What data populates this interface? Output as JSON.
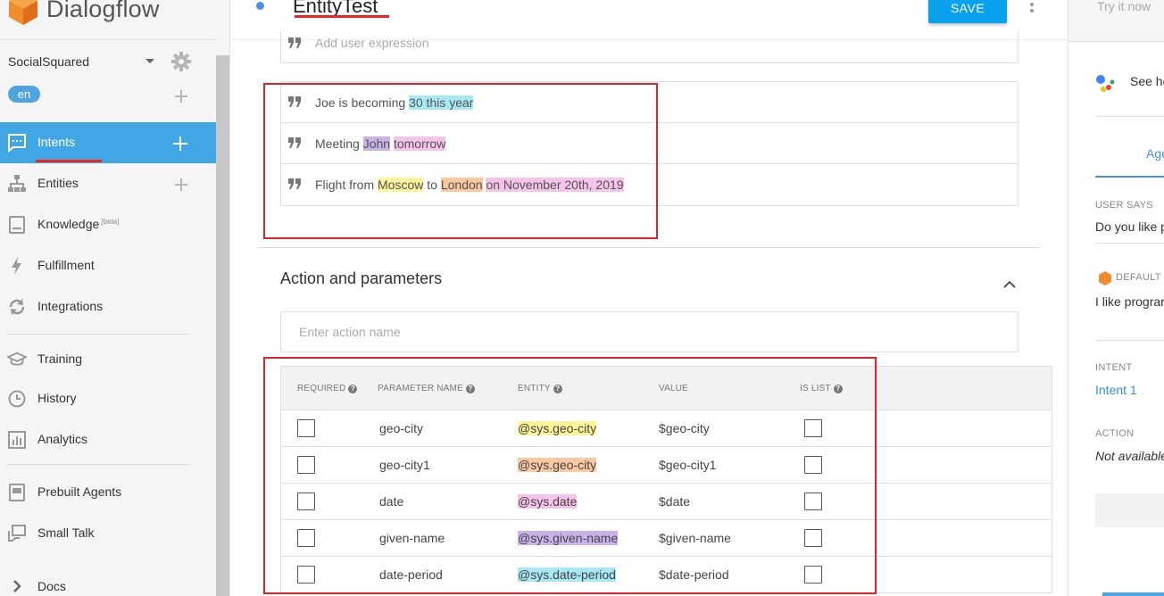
{
  "brand": {
    "name": "Dialogflow"
  },
  "agent": {
    "name": "SocialSquared",
    "language": "en"
  },
  "nav": {
    "intents": "Intents",
    "entities": "Entities",
    "knowledge": "Knowledge",
    "knowledge_badge": "[beta]",
    "fulfillment": "Fulfillment",
    "integrations": "Integrations",
    "training": "Training",
    "history": "History",
    "analytics": "Analytics",
    "prebuilt_agents": "Prebuilt Agents",
    "small_talk": "Small Talk",
    "docs": "Docs"
  },
  "header": {
    "intent_name": "EntityTest",
    "save_label": "SAVE"
  },
  "training_phrases": {
    "add_placeholder": "Add user expression",
    "phrases": [
      {
        "segments": [
          {
            "text": "Joe is becoming "
          },
          {
            "text": "30 this year",
            "entity": "cyan"
          }
        ]
      },
      {
        "segments": [
          {
            "text": "Meeting "
          },
          {
            "text": "John",
            "entity": "purple"
          },
          {
            "text": " "
          },
          {
            "text": "tomorrow",
            "entity": "pink"
          }
        ]
      },
      {
        "segments": [
          {
            "text": "Flight from "
          },
          {
            "text": "Moscow",
            "entity": "yellow"
          },
          {
            "text": " to "
          },
          {
            "text": "London",
            "entity": "orange"
          },
          {
            "text": " "
          },
          {
            "text": "on November 20th, 2019",
            "entity": "pink"
          }
        ]
      }
    ]
  },
  "action_section": {
    "title": "Action and parameters",
    "action_placeholder": "Enter action name",
    "columns": {
      "required": "REQUIRED",
      "parameter_name": "PARAMETER NAME",
      "entity": "ENTITY",
      "value": "VALUE",
      "is_list": "IS LIST"
    },
    "rows": [
      {
        "required": false,
        "name": "geo-city",
        "entity": "@sys.geo-city",
        "entity_color": "yellow",
        "value": "$geo-city",
        "is_list": false
      },
      {
        "required": false,
        "name": "geo-city1",
        "entity": "@sys.geo-city",
        "entity_color": "orange",
        "value": "$geo-city1",
        "is_list": false
      },
      {
        "required": false,
        "name": "date",
        "entity": "@sys.date",
        "entity_color": "pink",
        "value": "$date",
        "is_list": false
      },
      {
        "required": false,
        "name": "given-name",
        "entity": "@sys.given-name",
        "entity_color": "purple",
        "value": "$given-name",
        "is_list": false
      },
      {
        "required": false,
        "name": "date-period",
        "entity": "@sys.date-period",
        "entity_color": "cyan",
        "value": "$date-period",
        "is_list": false
      }
    ]
  },
  "right_panel": {
    "try_it": "Try it now",
    "see_how": "See ho",
    "tab": "Age",
    "user_says_label": "USER SAYS",
    "user_says_value": "Do you like p",
    "default_label": "DEFAULT",
    "default_value": "I like prograr",
    "intent_label": "INTENT",
    "intent_value": "Intent 1",
    "action_label": "ACTION",
    "action_value": "Not available"
  },
  "colors": {
    "accent": "#41a7e4",
    "save": "#0aa2ed",
    "annotation_red": "#e1232a",
    "cyan": "#a8e8f3",
    "purple": "#c9b3ea",
    "pink": "#f6c3ea",
    "yellow": "#fcf59a",
    "orange": "#fbc8a2"
  }
}
